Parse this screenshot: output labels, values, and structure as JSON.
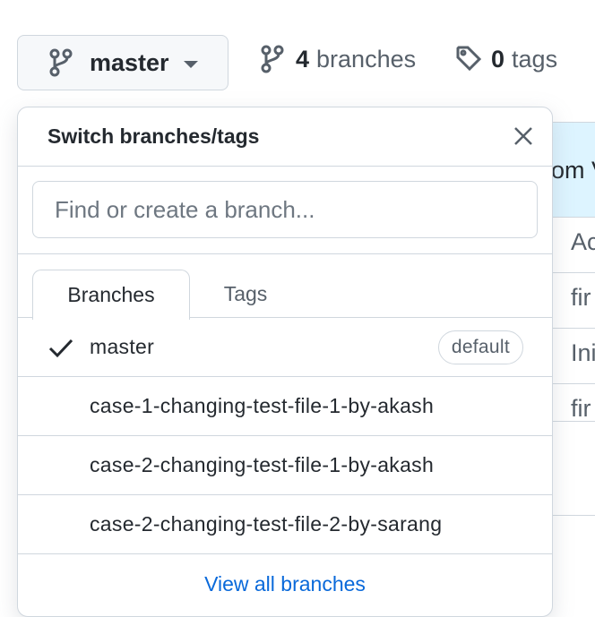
{
  "toolbar": {
    "branch_button_label": "master",
    "branches_count": "4",
    "branches_label": "branches",
    "tags_count": "0",
    "tags_label": "tags"
  },
  "background_table": {
    "header_text": "om V",
    "rows": [
      "Ac",
      "fir",
      "Ini",
      "fir",
      ""
    ]
  },
  "dropdown": {
    "title": "Switch branches/tags",
    "filter_placeholder": "Find or create a branch...",
    "tabs": [
      {
        "label": "Branches",
        "selected": true
      },
      {
        "label": "Tags",
        "selected": false
      }
    ],
    "items": [
      {
        "label": "master",
        "checked": true,
        "badge": "default"
      },
      {
        "label": "case-1-changing-test-file-1-by-akash",
        "checked": false
      },
      {
        "label": "case-2-changing-test-file-1-by-akash",
        "checked": false
      },
      {
        "label": "case-2-changing-test-file-2-by-sarang",
        "checked": false
      }
    ],
    "footer_link": "View all branches"
  },
  "colors": {
    "link": "#0969da",
    "border": "#d0d7de",
    "muted": "#57606a",
    "text": "#24292f",
    "button_bg": "#f6f8fa",
    "highlight_bg": "#ddf4ff"
  },
  "icons": {
    "branch": "git-branch-icon",
    "tag": "tag-icon",
    "close": "close-icon",
    "check": "check-icon",
    "caret": "caret-down-icon"
  }
}
